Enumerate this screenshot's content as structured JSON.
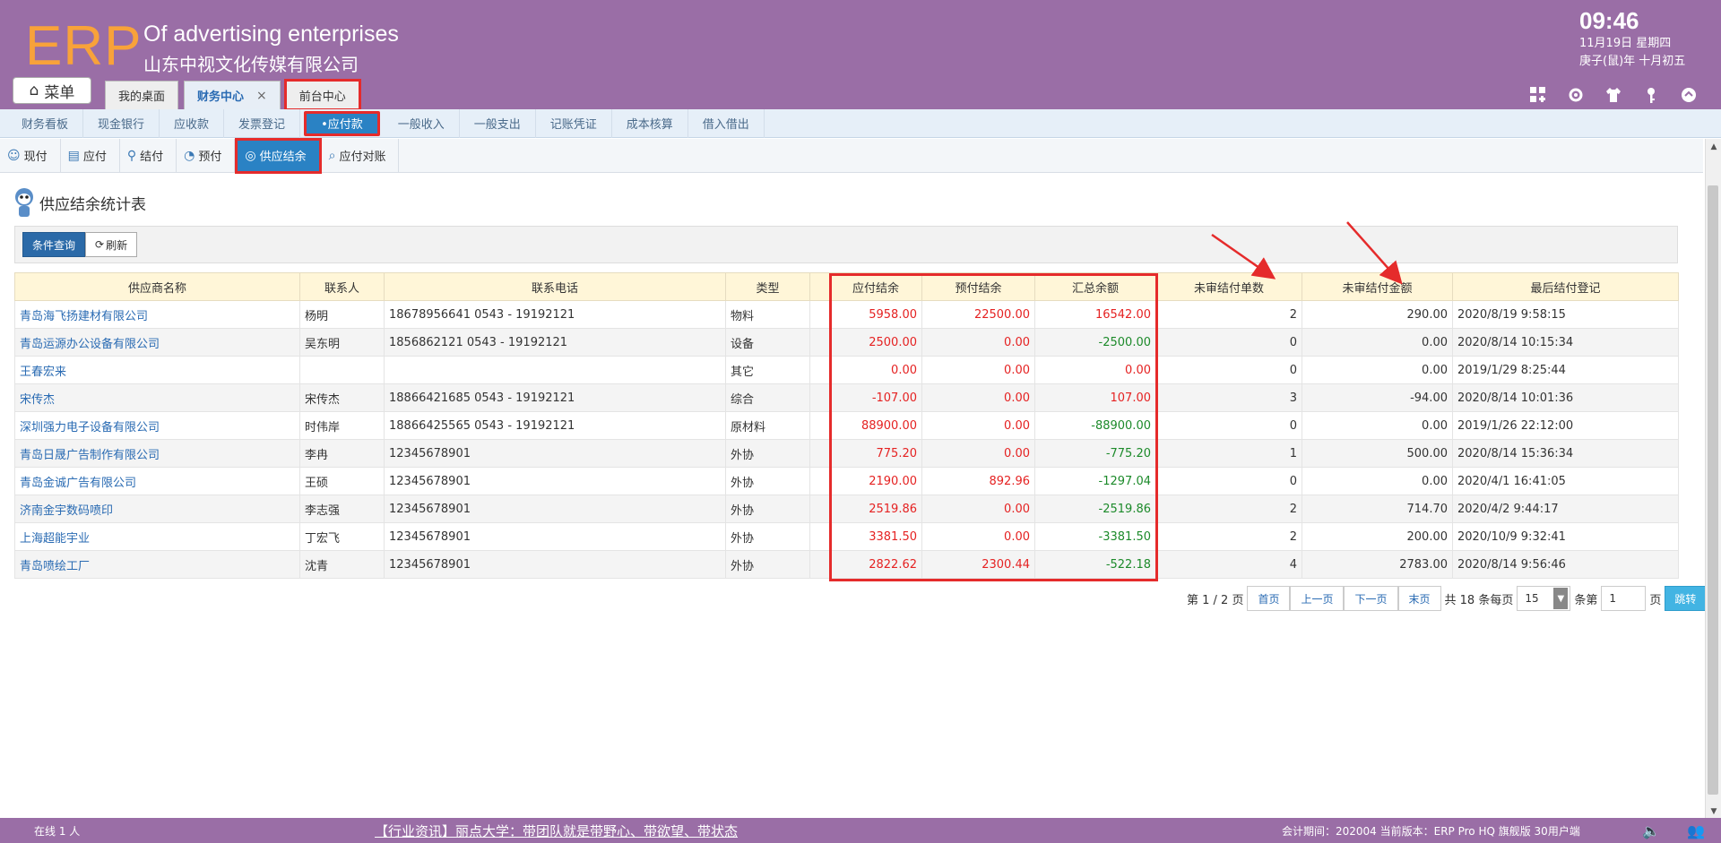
{
  "header": {
    "logo": "ERP",
    "company_en": "Of advertising enterprises",
    "company_cn": "山东中视文化传媒有限公司",
    "time": "09:46",
    "date": "11月19日 星期四",
    "lunar": "庚子(鼠)年 十月初五",
    "menu_label": "菜单",
    "tabs": [
      {
        "label": "我的桌面"
      },
      {
        "label": "财务中心",
        "close": "×"
      },
      {
        "label": "前台中心"
      }
    ],
    "icons": [
      "grid-add-icon",
      "gear-icon",
      "shirt-icon",
      "key-icon",
      "chevron-up-icon"
    ]
  },
  "module_nav": [
    {
      "label": "财务看板"
    },
    {
      "label": "现金银行"
    },
    {
      "label": "应收款"
    },
    {
      "label": "发票登记"
    },
    {
      "label": "•应付款"
    },
    {
      "label": "一般收入"
    },
    {
      "label": "一般支出"
    },
    {
      "label": "记账凭证"
    },
    {
      "label": "成本核算"
    },
    {
      "label": "借入借出"
    }
  ],
  "sub_nav": [
    {
      "label": "现付"
    },
    {
      "label": "应付"
    },
    {
      "label": "结付"
    },
    {
      "label": "预付"
    },
    {
      "label": "供应结余"
    },
    {
      "label": "应付对账"
    }
  ],
  "page_title": "供应结余统计表",
  "toolbar": {
    "query": "条件查询",
    "refresh": "刷新"
  },
  "table": {
    "headers": [
      "供应商名称",
      "联系人",
      "联系电话",
      "类型",
      "",
      "应付结余",
      "预付结余",
      "汇总余额",
      "未审结付单数",
      "未审结付金额",
      "最后结付登记"
    ],
    "rows": [
      [
        "青岛海飞扬建材有限公司",
        "杨明",
        "18678956641 0543 - 19192121",
        "物料",
        "",
        "5958.00",
        "22500.00",
        "16542.00",
        "2",
        "290.00",
        "2020/8/19 9:58:15"
      ],
      [
        "青岛运源办公设备有限公司",
        "吴东明",
        "1856862121 0543 - 19192121",
        "设备",
        "",
        "2500.00",
        "0.00",
        "-2500.00",
        "0",
        "0.00",
        "2020/8/14 10:15:34"
      ],
      [
        "王春宏来",
        "",
        "",
        "其它",
        "",
        "0.00",
        "0.00",
        "0.00",
        "0",
        "0.00",
        "2019/1/29 8:25:44"
      ],
      [
        "宋传杰",
        "宋传杰",
        "18866421685 0543 - 19192121",
        "综合",
        "",
        "-107.00",
        "0.00",
        "107.00",
        "3",
        "-94.00",
        "2020/8/14 10:01:36"
      ],
      [
        "深圳强力电子设备有限公司",
        "时伟岸",
        "18866425565 0543 - 19192121",
        "原材料",
        "",
        "88900.00",
        "0.00",
        "-88900.00",
        "0",
        "0.00",
        "2019/1/26 22:12:00"
      ],
      [
        "青岛日晟广告制作有限公司",
        "李冉",
        "12345678901",
        "外协",
        "",
        "775.20",
        "0.00",
        "-775.20",
        "1",
        "500.00",
        "2020/8/14 15:36:34"
      ],
      [
        "青岛金诚广告有限公司",
        "王硕",
        "12345678901",
        "外协",
        "",
        "2190.00",
        "892.96",
        "-1297.04",
        "0",
        "0.00",
        "2020/4/1 16:41:05"
      ],
      [
        "济南金宇数码喷印",
        "李志强",
        "12345678901",
        "外协",
        "",
        "2519.86",
        "0.00",
        "-2519.86",
        "2",
        "714.70",
        "2020/4/2 9:44:17"
      ],
      [
        "上海超能宇业",
        "丁宏飞",
        "12345678901",
        "外协",
        "",
        "3381.50",
        "0.00",
        "-3381.50",
        "2",
        "200.00",
        "2020/10/9 9:32:41"
      ],
      [
        "青岛喷绘工厂",
        "沈青",
        "12345678901",
        "外协",
        "",
        "2822.62",
        "2300.44",
        "-522.18",
        "4",
        "2783.00",
        "2020/8/14 9:56:46"
      ]
    ],
    "balance_colors": [
      [
        "red",
        "red",
        "red"
      ],
      [
        "red",
        "red",
        "green"
      ],
      [
        "red",
        "red",
        "red"
      ],
      [
        "red",
        "red",
        "red"
      ],
      [
        "red",
        "red",
        "green"
      ],
      [
        "red",
        "red",
        "green"
      ],
      [
        "red",
        "red",
        "green"
      ],
      [
        "red",
        "red",
        "green"
      ],
      [
        "red",
        "red",
        "green"
      ],
      [
        "red",
        "red",
        "green"
      ]
    ]
  },
  "pager": {
    "page_info": "第 1 / 2 页",
    "first": "首页",
    "prev": "上一页",
    "next": "下一页",
    "last": "末页",
    "total": "共 18 条每页",
    "page_size": "15",
    "goto_prefix": "条第",
    "goto_value": "1",
    "goto_suffix": "页",
    "go": "跳转"
  },
  "footer": {
    "online": "在线  1  人",
    "news": "【行业资讯】丽点大学：带团队就是带野心、带欲望、带状态",
    "info": "会计期间：202004 当前版本：ERP Pro HQ 旗舰版 30用户端"
  },
  "colors": {
    "header_bg": "#9a6ea6",
    "logo": "#f8a23a",
    "accent_blue": "#2a82c4",
    "highlight_red": "#e52b2b",
    "value_red": "#e52222",
    "value_green": "#1c8a2a"
  }
}
